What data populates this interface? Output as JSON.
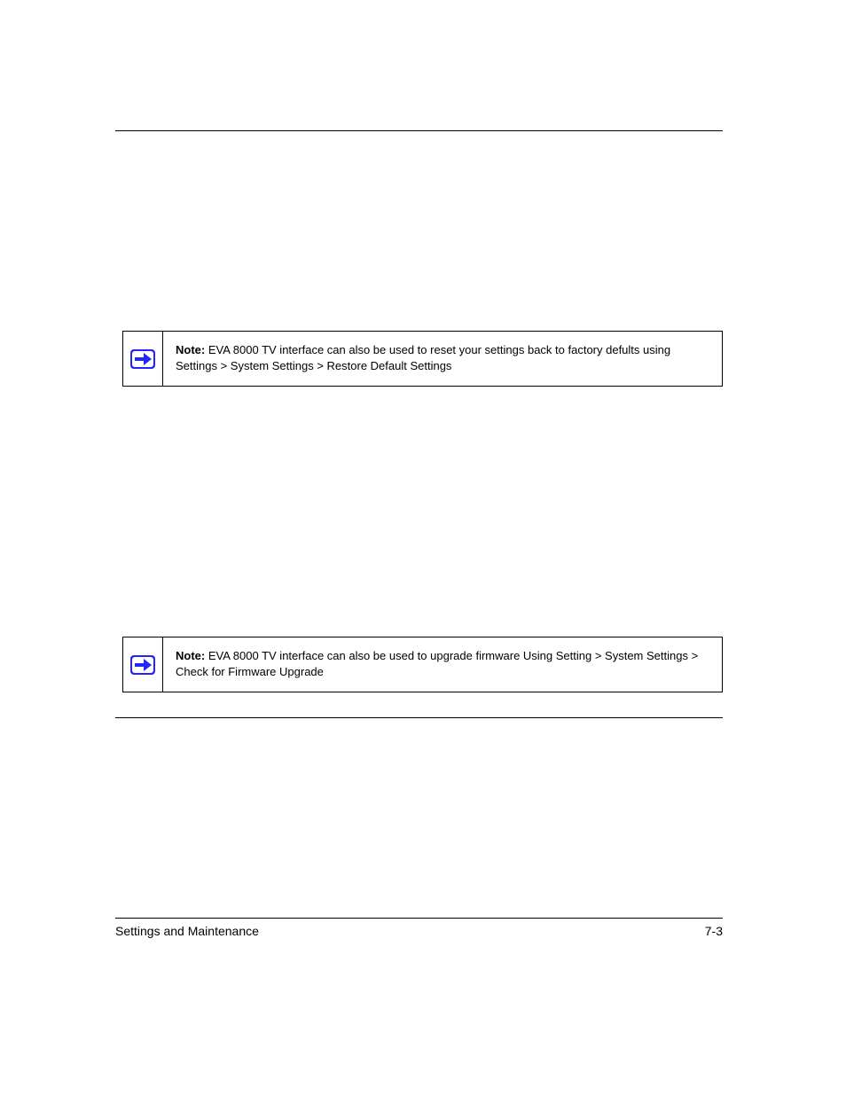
{
  "notes": [
    {
      "lead": "Note:",
      "text": "EVA 8000 TV interface can also be used to reset your settings back to factory defults using Settings > System Settings > Restore Default Settings "
    },
    {
      "lead": "Note:",
      "text": " EVA 8000 TV interface can also be used to upgrade firmware Using Setting > System Settings > Check for Firmware Upgrade"
    }
  ],
  "footer": {
    "left": "Settings and Maintenance",
    "right": "7-3"
  }
}
